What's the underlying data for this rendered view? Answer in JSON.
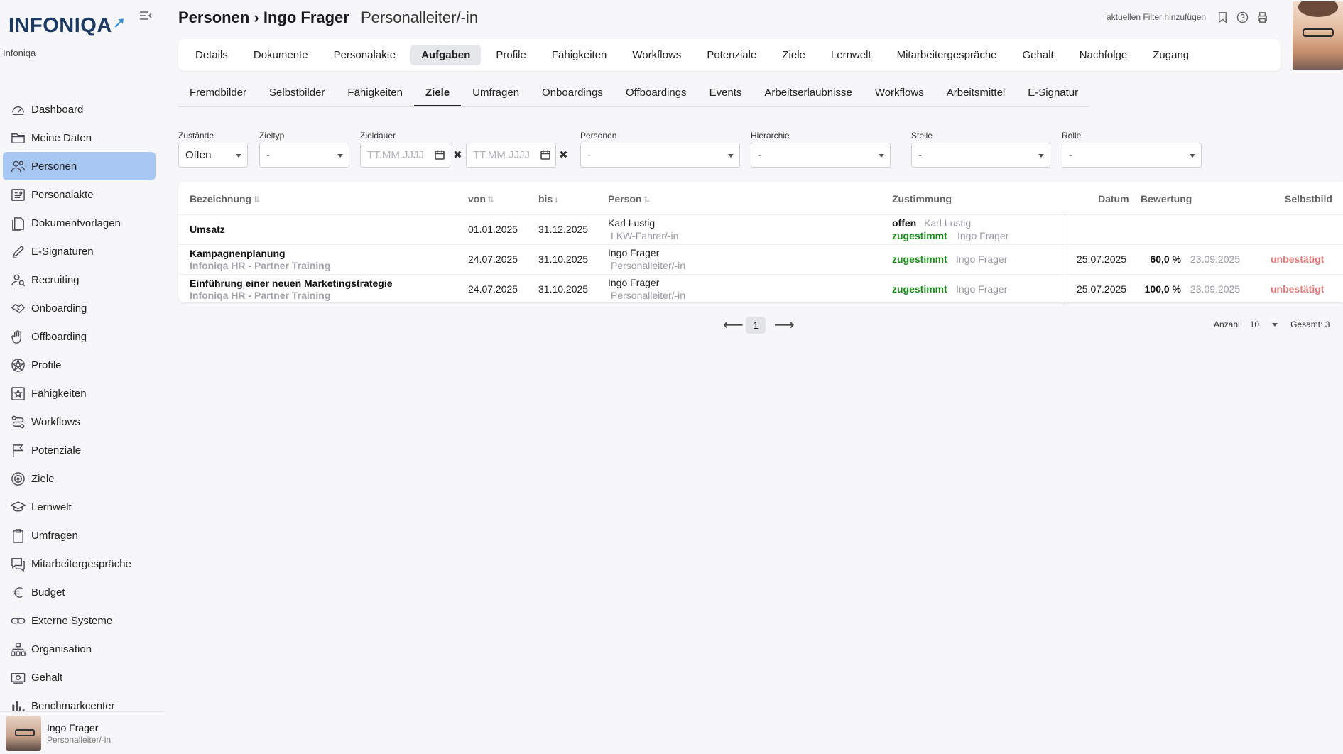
{
  "brand": {
    "logo": "INFONIQA",
    "org": "Infoniqa"
  },
  "sidebar": {
    "items": [
      {
        "label": "Dashboard",
        "icon": "gauge-icon"
      },
      {
        "label": "Meine Daten",
        "icon": "folder-icon"
      },
      {
        "label": "Personen",
        "icon": "users-icon"
      },
      {
        "label": "Personalakte",
        "icon": "id-card-icon"
      },
      {
        "label": "Dokumentvorlagen",
        "icon": "documents-icon"
      },
      {
        "label": "E-Signaturen",
        "icon": "pen-icon"
      },
      {
        "label": "Recruiting",
        "icon": "user-search-icon"
      },
      {
        "label": "Onboarding",
        "icon": "handshake-icon"
      },
      {
        "label": "Offboarding",
        "icon": "hand-icon"
      },
      {
        "label": "Profile",
        "icon": "pentagram-icon"
      },
      {
        "label": "Fähigkeiten",
        "icon": "star-box-icon"
      },
      {
        "label": "Workflows",
        "icon": "route-icon"
      },
      {
        "label": "Potenziale",
        "icon": "flag-icon"
      },
      {
        "label": "Ziele",
        "icon": "target-icon"
      },
      {
        "label": "Lernwelt",
        "icon": "graduation-cap-icon"
      },
      {
        "label": "Umfragen",
        "icon": "clipboard-icon"
      },
      {
        "label": "Mitarbeitergespräche",
        "icon": "chat-icon"
      },
      {
        "label": "Budget",
        "icon": "euro-icon"
      },
      {
        "label": "Externe Systeme",
        "icon": "link-icon"
      },
      {
        "label": "Organisation",
        "icon": "org-chart-icon"
      },
      {
        "label": "Gehalt",
        "icon": "money-icon"
      },
      {
        "label": "Benchmarkcenter",
        "icon": "bar-chart-icon"
      }
    ],
    "active": "Personen"
  },
  "user": {
    "name": "Ingo Frager",
    "role": "Personalleiter/-in"
  },
  "header": {
    "crumb_root": "Personen",
    "separator": "›",
    "crumb_name": "Ingo Frager",
    "subtitle": "Personalleiter/-in",
    "filter_link": "aktuellen Filter hinzufügen"
  },
  "tabs": [
    "Details",
    "Dokumente",
    "Personalakte",
    "Aufgaben",
    "Profile",
    "Fähigkeiten",
    "Workflows",
    "Potenziale",
    "Ziele",
    "Lernwelt",
    "Mitarbeitergespräche",
    "Gehalt",
    "Nachfolge",
    "Zugang"
  ],
  "active_tab": "Aufgaben",
  "subtabs": [
    "Fremdbilder",
    "Selbstbilder",
    "Fähigkeiten",
    "Ziele",
    "Umfragen",
    "Onboardings",
    "Offboardings",
    "Events",
    "Arbeitserlaubnisse",
    "Workflows",
    "Arbeitsmittel",
    "E-Signatur"
  ],
  "active_subtab": "Ziele",
  "filters": {
    "zustaende": {
      "label": "Zustände",
      "value": "Offen"
    },
    "zieltyp": {
      "label": "Zieltyp",
      "value": "-"
    },
    "zieldauer": {
      "label": "Zieldauer",
      "from_placeholder": "TT.MM.JJJJ",
      "to_placeholder": "TT.MM.JJJJ"
    },
    "personen": {
      "label": "Personen",
      "value": "-"
    },
    "hierarchie": {
      "label": "Hierarchie",
      "value": "-"
    },
    "stelle": {
      "label": "Stelle",
      "value": "-"
    },
    "rolle": {
      "label": "Rolle",
      "value": "-"
    }
  },
  "table": {
    "columns": {
      "bezeichnung": "Bezeichnung",
      "von": "von",
      "bis": "bis",
      "person": "Person",
      "zustimmung": "Zustimmung",
      "datum": "Datum",
      "bewertung": "Bewertung",
      "selbstbild": "Selbstbild"
    },
    "rows": [
      {
        "title": "Umsatz",
        "subtitle": "",
        "von": "01.01.2025",
        "bis": "31.12.2025",
        "person": "Karl Lustig",
        "person_role": "LKW-Fahrer/-in",
        "approvals": [
          {
            "status": "offen",
            "by": "Karl Lustig"
          },
          {
            "status": "zugestimmt",
            "by": "Ingo Frager"
          }
        ],
        "datum": "",
        "bewertung": "",
        "bewertung_date": "",
        "selbstbild": ""
      },
      {
        "title": "Kampagnenplanung",
        "subtitle": "Infoniqa HR - Partner Training",
        "von": "24.07.2025",
        "bis": "31.10.2025",
        "person": "Ingo Frager",
        "person_role": "Personalleiter/-in",
        "approvals": [
          {
            "status": "zugestimmt",
            "by": "Ingo Frager"
          }
        ],
        "datum": "25.07.2025",
        "bewertung": "60,0 %",
        "bewertung_date": "23.09.2025",
        "selbstbild": "unbestätigt"
      },
      {
        "title": "Einführung einer neuen Marketingstrategie",
        "subtitle": "Infoniqa HR - Partner Training",
        "von": "24.07.2025",
        "bis": "31.10.2025",
        "person": "Ingo Frager",
        "person_role": "Personalleiter/-in",
        "approvals": [
          {
            "status": "zugestimmt",
            "by": "Ingo Frager"
          }
        ],
        "datum": "25.07.2025",
        "bewertung": "100,0 %",
        "bewertung_date": "23.09.2025",
        "selbstbild": "unbestätigt"
      }
    ]
  },
  "pagination": {
    "page": "1",
    "count_label": "Anzahl",
    "count_value": "10",
    "total": "Gesamt: 3"
  },
  "colors": {
    "active_nav": "#a8c8f4",
    "approved": "#1b8a1b",
    "unconfirmed": "#e27a7a",
    "logo": "#1d3b62",
    "logo_arrow": "#2d8fe0"
  }
}
